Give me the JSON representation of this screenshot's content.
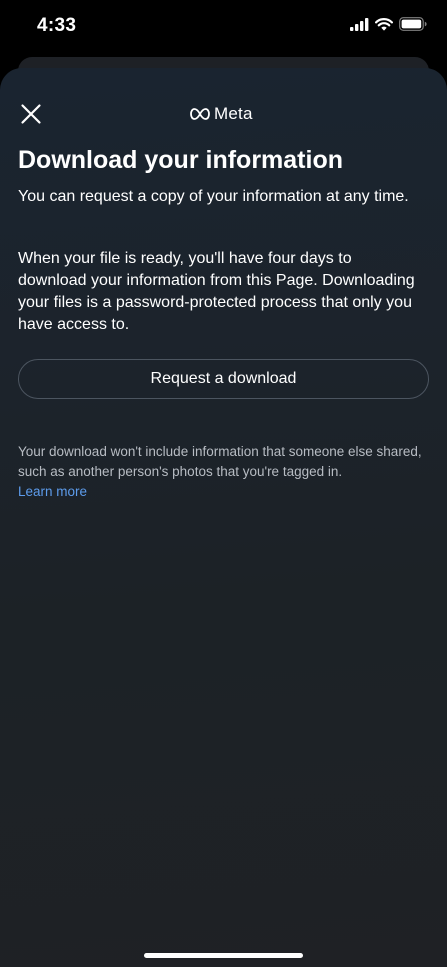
{
  "status_bar": {
    "time": "4:33",
    "icons": [
      "signal-icon",
      "wifi-icon",
      "battery-icon"
    ]
  },
  "header": {
    "close_icon": "close-icon",
    "brand_logo": "meta-infinity-icon",
    "brand_name": "Meta"
  },
  "main": {
    "title": "Download your information",
    "intro": "You can request a copy of your information at any time.",
    "detail": "When your file is ready, you'll have four days to download your information from this Page. Downloading your files is a password-protected process that only you have access to.",
    "request_button_label": "Request a download",
    "note": "Your download won't include information that someone else shared, such as another person's photos that you're tagged in.",
    "learn_more_label": "Learn more"
  },
  "colors": {
    "background": "#000000",
    "sheet": "#1c232b",
    "link": "#5d9cec",
    "button_border": "#4c5560",
    "note_text": "#b7bcc3"
  }
}
